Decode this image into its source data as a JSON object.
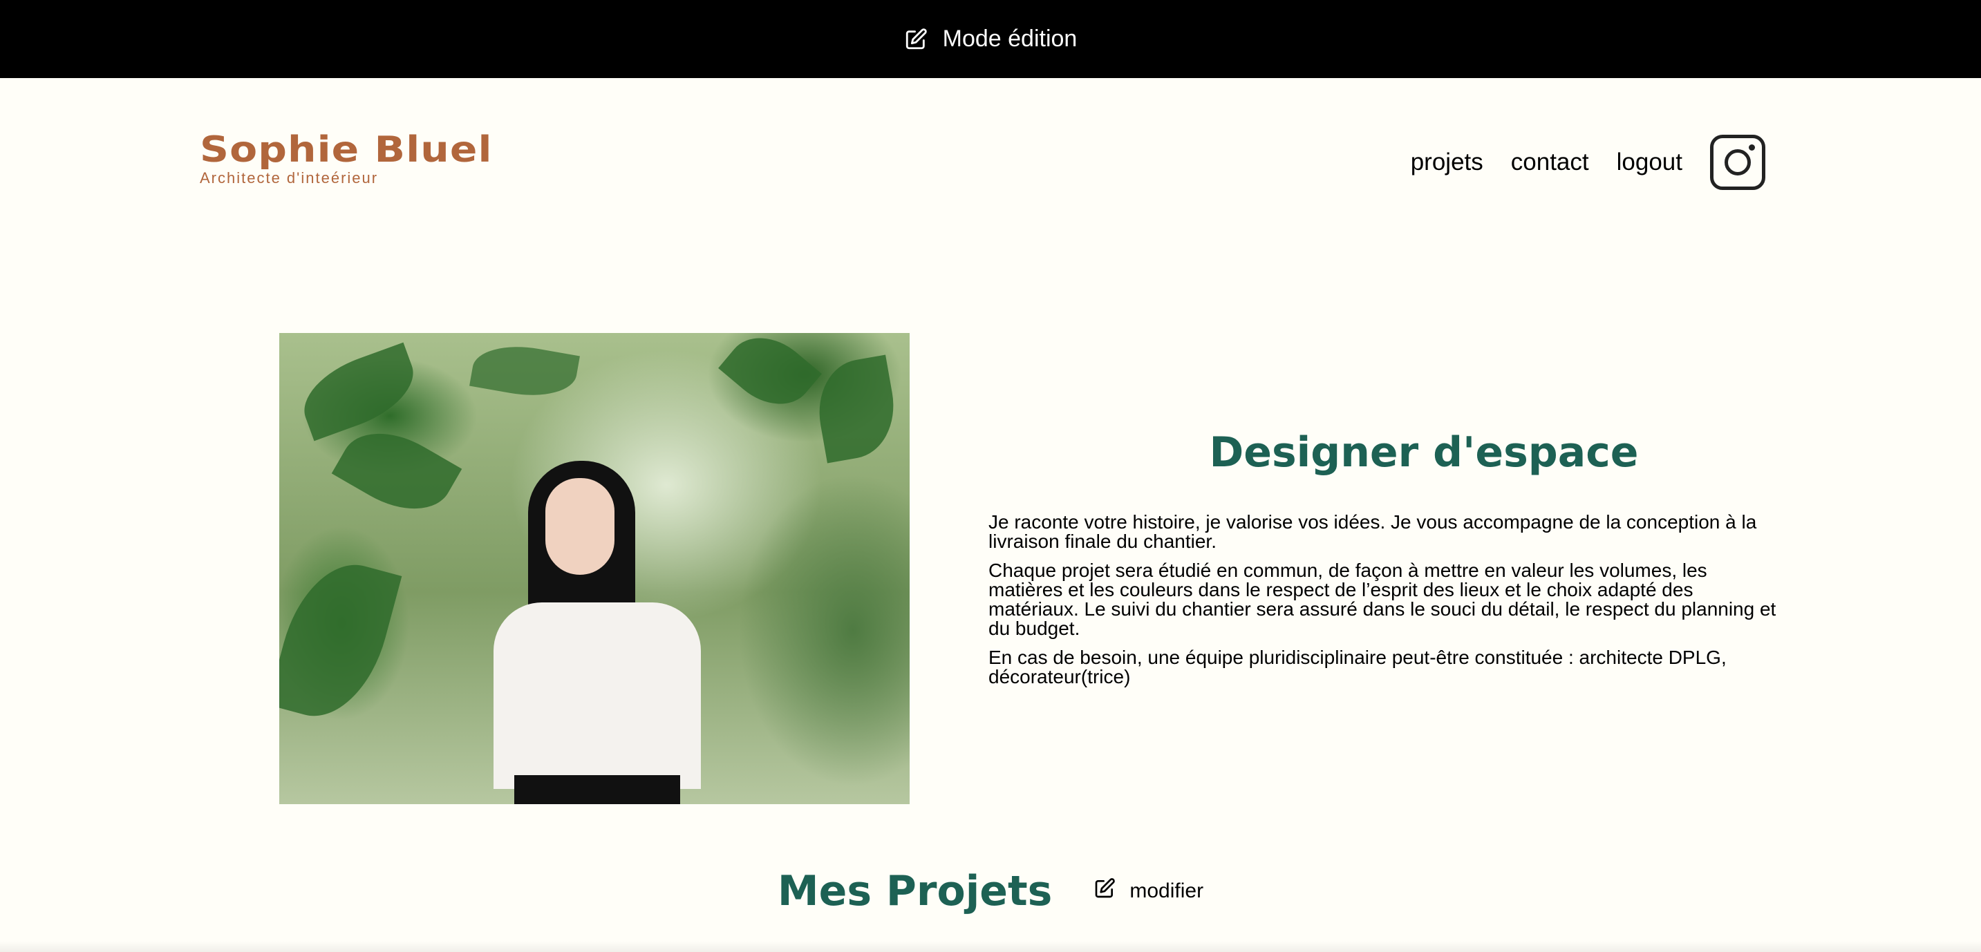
{
  "edit_bar": {
    "label": "Mode édition",
    "icon": "edit-icon"
  },
  "header": {
    "logo_name": "Sophie Bluel",
    "logo_subtitle": "Architecte d'inteérieur",
    "nav": [
      {
        "label": "projets"
      },
      {
        "label": "contact"
      },
      {
        "label": "logout"
      }
    ],
    "social_icon": "instagram-icon"
  },
  "intro": {
    "photo_alt": "portrait photo",
    "title": "Designer d'espace",
    "paragraphs": [
      "Je raconte votre histoire, je valorise vos idées. Je vous accompagne de la conception à la livraison finale du chantier.",
      "Chaque projet sera étudié en commun, de façon à mettre en valeur les volumes, les matières et les couleurs dans le respect de l’esprit des lieux et le choix adapté des matériaux. Le suivi du chantier sera assuré dans le souci du détail, le respect du planning et du budget.",
      "En cas de besoin, une équipe pluridisciplinaire peut-être constituée : architecte DPLG, décorateur(trice)"
    ]
  },
  "projects": {
    "title": "Mes Projets",
    "modify_label": "modifier",
    "icon": "edit-icon"
  },
  "colors": {
    "accent_green": "#1d6154",
    "logo_brown": "#b1663c",
    "background": "#fffef8"
  }
}
